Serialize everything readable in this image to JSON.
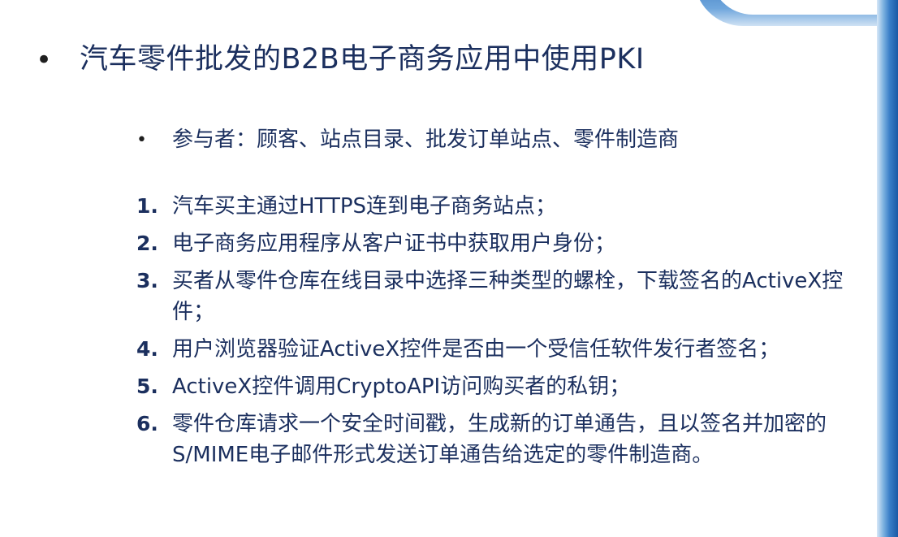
{
  "heading": {
    "bullet": "•",
    "title": "汽车零件批发的B2B电子商务应用中使用PKI"
  },
  "participants": {
    "bullet": "•",
    "text": "参与者：顾客、站点目录、批发订单站点、零件制造商"
  },
  "steps": [
    {
      "number": "1.",
      "text": "汽车买主通过HTTPS连到电子商务站点；"
    },
    {
      "number": "2.",
      "text": "电子商务应用程序从客户证书中获取用户身份；"
    },
    {
      "number": "3.",
      "text": "买者从零件仓库在线目录中选择三种类型的螺栓，下载签名的ActiveX控件；"
    },
    {
      "number": "4.",
      "text": "用户浏览器验证ActiveX控件是否由一个受信任软件发行者签名；"
    },
    {
      "number": "5.",
      "text": "ActiveX控件调用CryptoAPI访问购买者的私钥；"
    },
    {
      "number": "6.",
      "text": "零件仓库请求一个安全时间戳，生成新的订单通告，且以签名并加密的S/MIME电子邮件形式发送订单通告给选定的零件制造商。"
    }
  ],
  "colors": {
    "text": "#1b2f5e",
    "accent_blue": "#2f6fb8"
  }
}
